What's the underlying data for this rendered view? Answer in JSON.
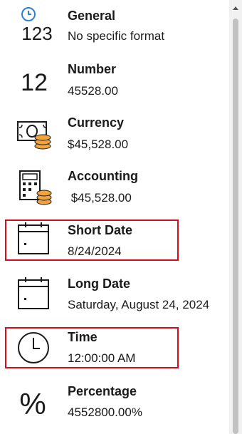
{
  "formats": [
    {
      "id": "general",
      "name": "General",
      "sample": "No specific format",
      "icon": "general-format-icon",
      "icon_text": "123"
    },
    {
      "id": "number",
      "name": "Number",
      "sample": "45528.00",
      "icon": "number-format-icon",
      "icon_text": "12"
    },
    {
      "id": "currency",
      "name": "Currency",
      "sample": "$45,528.00",
      "icon": "currency-icon"
    },
    {
      "id": "accounting",
      "name": "Accounting",
      "sample": " $45,528.00",
      "icon": "accounting-icon"
    },
    {
      "id": "short-date",
      "name": "Short Date",
      "sample": "8/24/2024",
      "icon": "calendar-icon",
      "highlighted": true
    },
    {
      "id": "long-date",
      "name": "Long Date",
      "sample": "Saturday, August 24, 2024",
      "icon": "calendar-icon"
    },
    {
      "id": "time",
      "name": "Time",
      "sample": "12:00:00 AM",
      "icon": "clock-icon",
      "highlighted": true
    },
    {
      "id": "percentage",
      "name": "Percentage",
      "sample": "4552800.00%",
      "icon": "percent-icon",
      "icon_text": "%"
    }
  ],
  "colors": {
    "highlight_border": "#d20f1f",
    "clock_accent": "#2f7fd1",
    "coin": "#f2a33a",
    "text": "#1a1a1a"
  }
}
